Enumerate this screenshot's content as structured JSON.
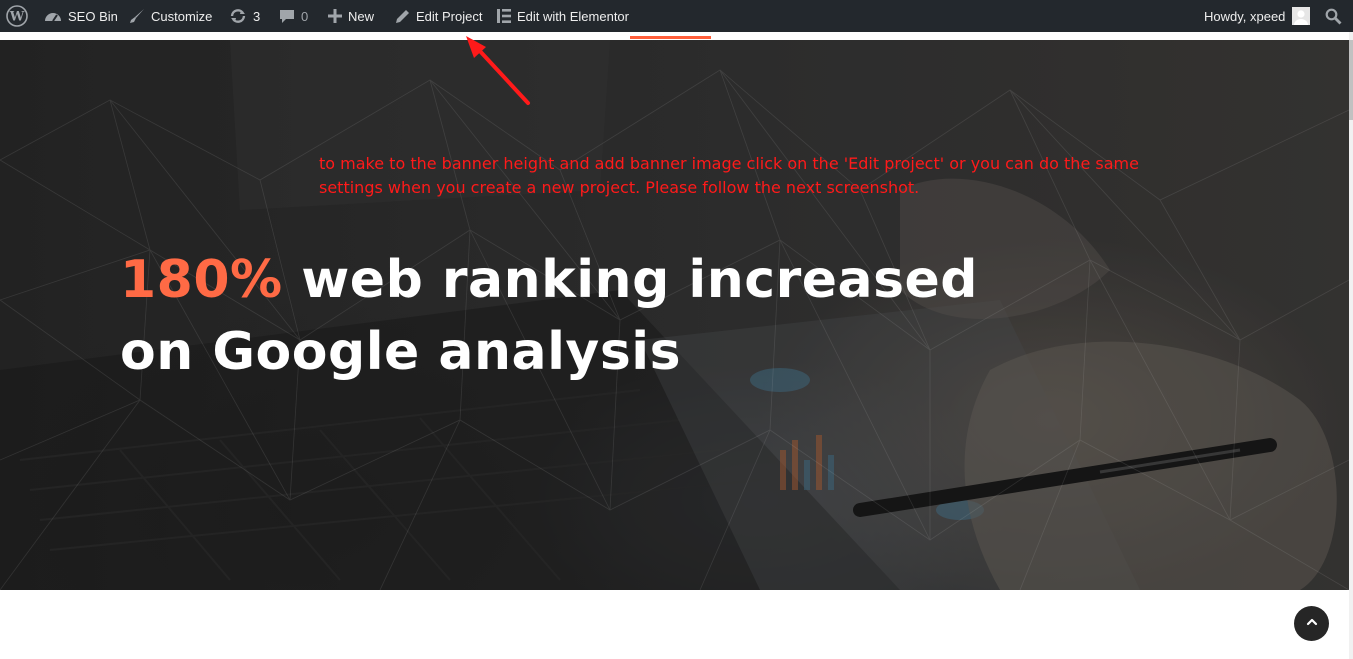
{
  "admin_bar": {
    "site_name": "SEO Bin",
    "customize": "Customize",
    "updates_count": "3",
    "comments_count": "0",
    "new_label": "New",
    "edit_project": "Edit Project",
    "edit_elementor": "Edit with Elementor",
    "howdy": "Howdy, xpeed"
  },
  "hero": {
    "headline_highlight": "180%",
    "headline_line1_rest": " web ranking increased",
    "headline_line2": "on Google analysis"
  },
  "annotation": {
    "text": "to make to the banner height and add banner image click on the 'Edit project' or you can do the same settings when you create a new project. Please follow the next screenshot."
  },
  "colors": {
    "admin_bar_bg": "#23282d",
    "accent": "#ff6a45",
    "annotation": "#ff1a1a",
    "back_to_top_bg": "#262626"
  },
  "icons": [
    "wordpress-icon",
    "dashboard-icon",
    "brush-icon",
    "updates-icon",
    "comment-icon",
    "plus-icon",
    "pencil-icon",
    "elementor-icon",
    "user-avatar",
    "search-icon",
    "chevron-up-icon"
  ]
}
